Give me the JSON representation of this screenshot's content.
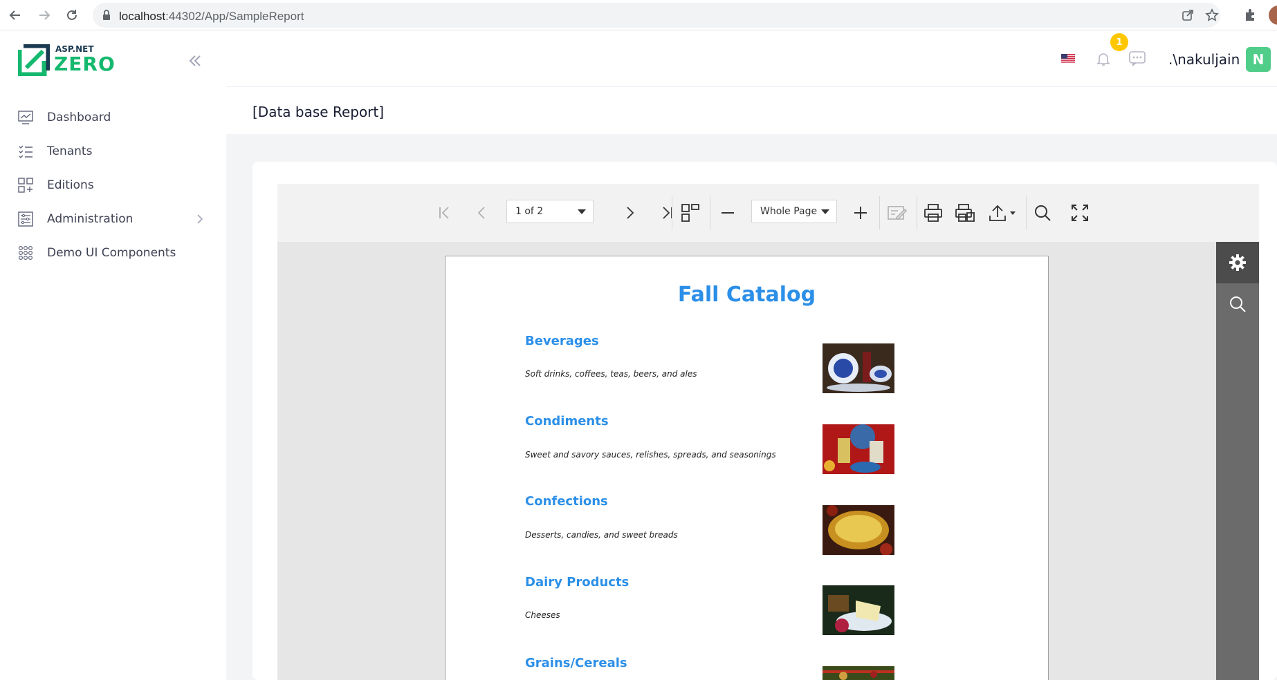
{
  "browser": {
    "url_host": "localhost",
    "url_path": ":44302/App/SampleReport"
  },
  "sidebar": {
    "logo_top": "ASP.NET",
    "logo_bottom": "ZERO",
    "items": [
      {
        "label": "Dashboard",
        "icon": "chart-icon"
      },
      {
        "label": "Tenants",
        "icon": "list-icon"
      },
      {
        "label": "Editions",
        "icon": "grid-icon"
      },
      {
        "label": "Administration",
        "icon": "settings-list-icon",
        "has_children": true
      },
      {
        "label": "Demo UI Components",
        "icon": "dots-grid-icon"
      }
    ]
  },
  "header": {
    "notification_count": "1",
    "username": ".\\nakuljain",
    "avatar_letter": "N"
  },
  "subheader": {
    "title": "[Data base Report]"
  },
  "viewer": {
    "page_select": "1 of 2",
    "zoom_select": "Whole Page"
  },
  "report": {
    "title": "Fall Catalog",
    "categories": [
      {
        "name": "Beverages",
        "description": "Soft drinks, coffees, teas, beers, and ales"
      },
      {
        "name": "Condiments",
        "description": "Sweet and savory sauces, relishes, spreads, and seasonings"
      },
      {
        "name": "Confections",
        "description": "Desserts, candies, and sweet breads"
      },
      {
        "name": "Dairy Products",
        "description": "Cheeses"
      },
      {
        "name": "Grains/Cereals",
        "description": ""
      }
    ]
  },
  "colors": {
    "brand_green": "#14b86e",
    "report_blue": "#2b8fe8",
    "badge_yellow": "#ffc700",
    "avatar_green": "#50cd89"
  }
}
